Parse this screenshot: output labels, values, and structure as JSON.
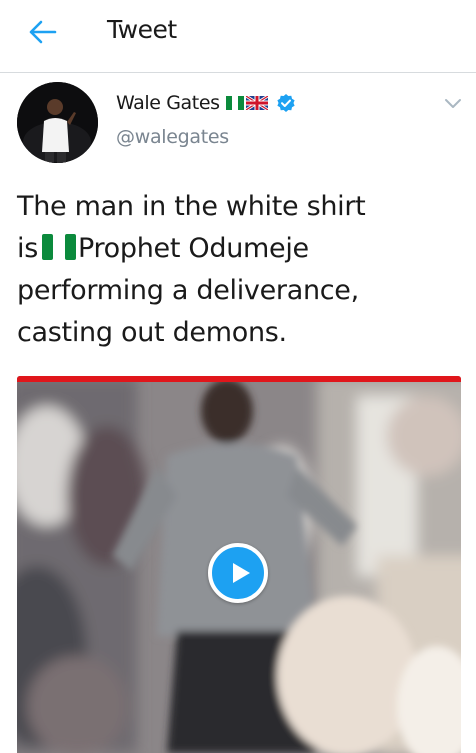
{
  "header": {
    "title": "Tweet"
  },
  "tweet": {
    "author_name": "Wale Gates",
    "author_handle": "@walegates",
    "text_lines": [
      "The man in the white shirt",
      "Prophet Odumeje",
      "performing a deliverance,",
      "casting out demons."
    ],
    "text_prefix_line2": "is",
    "name_flags": [
      "nigeria-flag-icon",
      "uk-flag-icon"
    ],
    "verified_badge": "verified-badge-icon"
  },
  "media": {
    "type": "video",
    "play_icon": "play-icon"
  },
  "colors": {
    "twitter_blue": "#1da1f2",
    "video_bar_red": "#e0161b",
    "handle_gray": "#7a8590",
    "divider": "#d7dbde"
  }
}
